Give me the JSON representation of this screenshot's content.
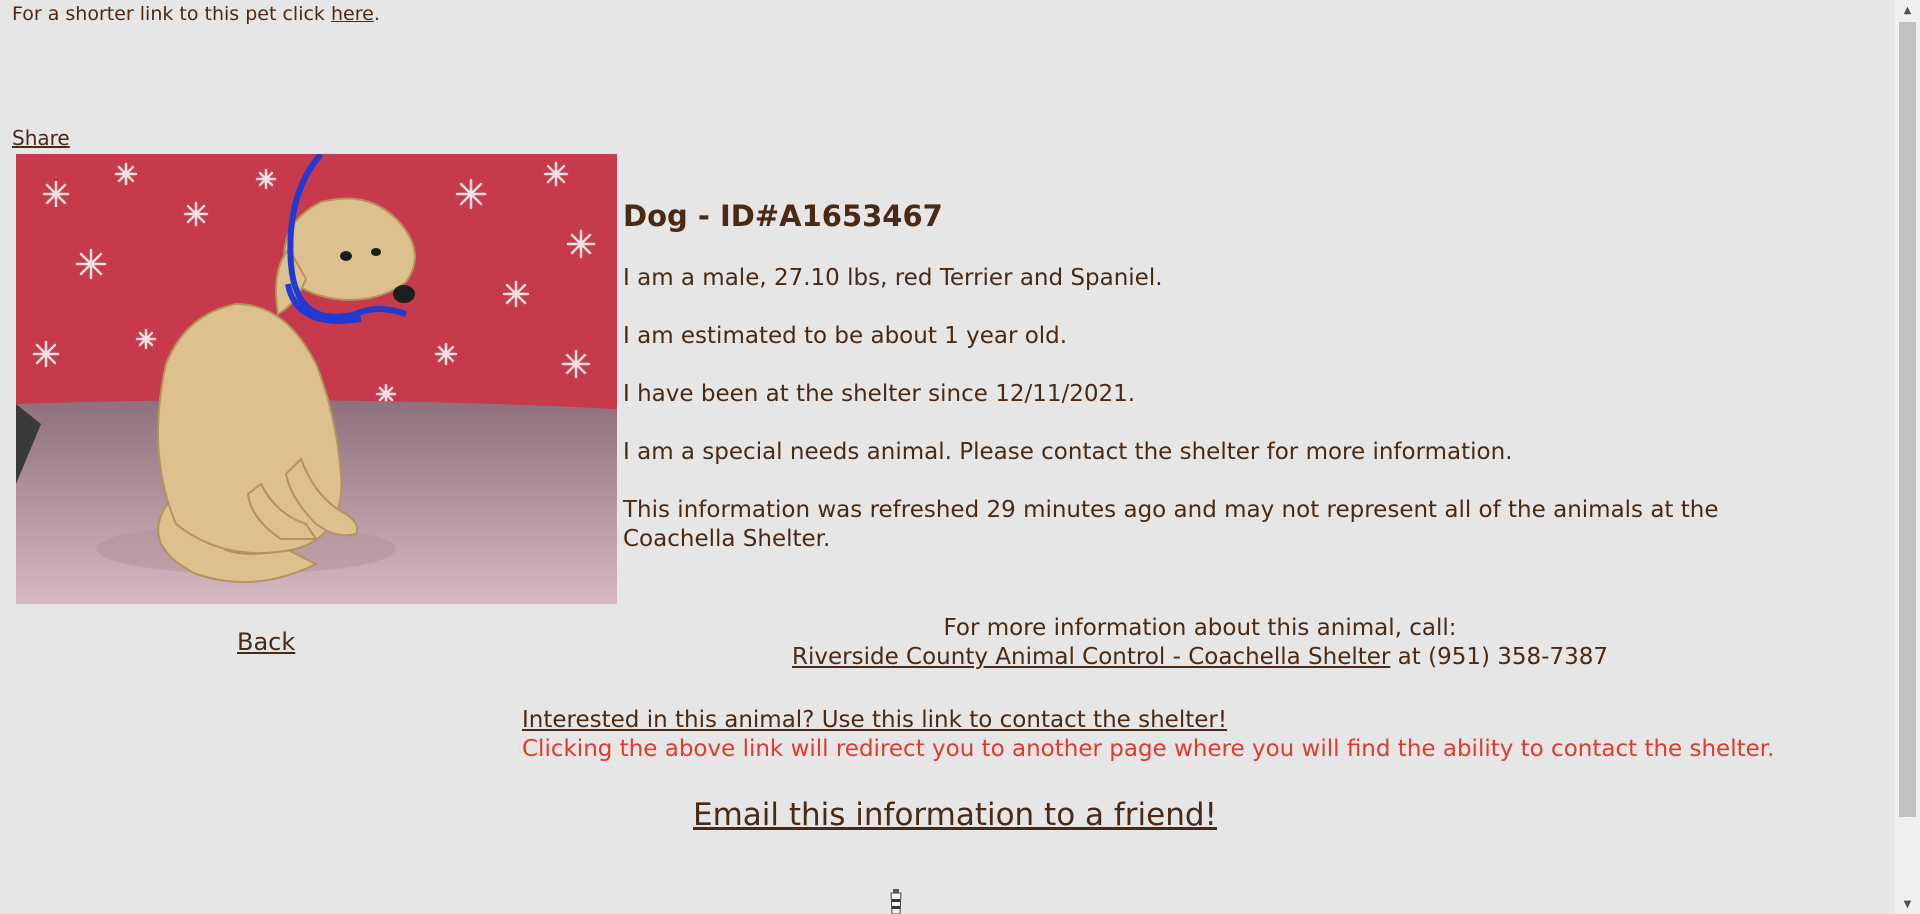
{
  "top": {
    "prefix": "For a shorter link to this pet click ",
    "link": "here",
    "suffix": "."
  },
  "share": "Share",
  "photo": {
    "alt": "Photo of a tan Terrier and Spaniel dog on a red snowflake backdrop"
  },
  "back": "Back",
  "details": {
    "heading": "Dog - ID#A1653467",
    "line1": "I am a male, 27.10 lbs, red Terrier and Spaniel.",
    "line2": "I am estimated to be about 1 year old.",
    "line3": "I have been at the shelter since 12/11/2021.",
    "line4": "I am a special needs animal. Please contact the shelter for more information.",
    "line5": "This information was refreshed 29 minutes ago and may not represent all of the animals at the Coachella Shelter."
  },
  "contact": {
    "intro": "For more information about this animal, call:",
    "shelter_link": "Riverside County Animal Control - Coachella Shelter",
    "phone": " at (951) 358-7387"
  },
  "interest": {
    "link": "Interested in this animal? Use this link to contact the shelter!",
    "note": "Clicking the above link will redirect you to another page where you will find the ability to contact the shelter."
  },
  "email": "Email this information to a friend!",
  "colors": {
    "background": "#e6e6e6",
    "text": "#4a2a14",
    "note": "#e03a2e"
  },
  "icons": {
    "bottom": "lighthouse-icon",
    "scroll_up": "chevron-up-icon",
    "scroll_down": "chevron-down-icon"
  }
}
